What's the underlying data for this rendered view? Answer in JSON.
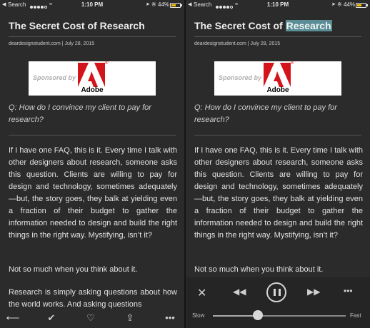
{
  "status_bar": {
    "back_label": "Search",
    "time": "1:10 PM",
    "battery": "44%",
    "battery_level": 0.44,
    "signal_bars": 4,
    "signal_total": 5
  },
  "article": {
    "title_prefix": "The Secret Cost of ",
    "title_word": "Research",
    "meta": "deardesignstudent.com | July 28, 2015",
    "ad_sponsor": "Sponsored by",
    "ad_brand": "Adobe",
    "question": "Q: How do I convince my client to pay for research?",
    "paragraph_1": "If I have one FAQ, this is it. Every time I talk with other designers about research, someone asks this question. Clients are willing to pay for design and technology, sometimes adequately—but, the story goes, they balk at yielding even a fraction of their budget to gather the information needed to design and build the right things in the right way. Mystifying, isn’t it?",
    "paragraph_2": "Not so much when you think about it.",
    "paragraph_3": "Research is simply asking questions about how the world works. And asking questions"
  },
  "toolbar": {
    "icons": [
      "back-arrow-icon",
      "checkmark-icon",
      "heart-bubble-icon",
      "share-icon",
      "more-icon"
    ]
  },
  "player": {
    "slow_label": "Slow",
    "fast_label": "Fast",
    "speed_level": 0.34
  },
  "colors": {
    "background": "#2b2b2b",
    "highlight": "#5b8d96",
    "battery": "#f5c400"
  }
}
